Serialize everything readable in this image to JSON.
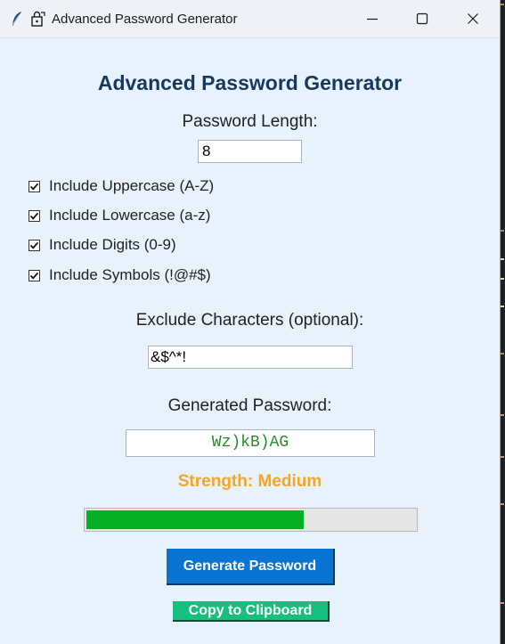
{
  "window": {
    "title": "Advanced Password Generator"
  },
  "app": {
    "heading": "Advanced Password Generator",
    "length_label": "Password Length:",
    "length_value": "8",
    "options": [
      {
        "label": "Include Uppercase (A-Z)",
        "checked": true
      },
      {
        "label": "Include Lowercase (a-z)",
        "checked": true
      },
      {
        "label": "Include Digits (0-9)",
        "checked": true
      },
      {
        "label": "Include Symbols (!@#$)",
        "checked": true
      }
    ],
    "exclude_label": "Exclude Characters (optional):",
    "exclude_value": "&$^*!",
    "generated_label": "Generated Password:",
    "generated_password": "Wz)kB)AG",
    "strength_text": "Strength: Medium",
    "strength_progress": 0.66,
    "generate_button": "Generate Password",
    "copy_button": "Copy to Clipboard"
  },
  "colors": {
    "heading": "#17395e",
    "strength": "#f5a623",
    "password_text": "#2a8a2a",
    "progress_fill": "#06b025",
    "generate_button": "#0a74d3",
    "copy_button": "#17bf7f",
    "window_bg": "#e8f2fd"
  },
  "icons": {
    "title_left": "feather-icon",
    "app": "app-lock-icon",
    "minimize": "minimize-icon",
    "maximize": "maximize-icon",
    "close": "close-icon",
    "check": "check-icon"
  }
}
